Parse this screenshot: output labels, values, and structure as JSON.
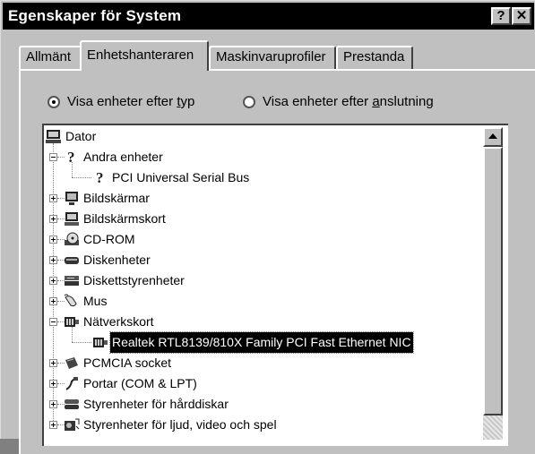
{
  "window": {
    "title": "Egenskaper för System"
  },
  "titlebar": {
    "help_label": "?",
    "close_label": "✕"
  },
  "tabs": [
    {
      "label": "Allmänt"
    },
    {
      "label": "Enhetshanteraren"
    },
    {
      "label": "Maskinvaruprofiler"
    },
    {
      "label": "Prestanda"
    }
  ],
  "view_options": {
    "by_type": {
      "pre": "Visa enheter efter ",
      "ul": "t",
      "post": "yp",
      "checked": true
    },
    "by_connection": {
      "pre": "Visa enheter efter ",
      "ul": "a",
      "post": "nslutning",
      "checked": false
    }
  },
  "tree": {
    "root": {
      "label": "Dator",
      "icon": "computer-icon"
    },
    "items": [
      {
        "label": "Andra enheter",
        "icon": "question-icon",
        "expanded": true
      },
      {
        "label": "PCI Universal Serial Bus",
        "icon": "question-icon",
        "child": true
      },
      {
        "label": "Bildskärmar",
        "icon": "monitor-icon"
      },
      {
        "label": "Bildskärmskort",
        "icon": "display-adapter-icon"
      },
      {
        "label": "CD-ROM",
        "icon": "cdrom-icon"
      },
      {
        "label": "Diskenheter",
        "icon": "disk-drive-icon"
      },
      {
        "label": "Diskettstyrenheter",
        "icon": "floppy-controller-icon"
      },
      {
        "label": "Mus",
        "icon": "mouse-icon"
      },
      {
        "label": "Nätverkskort",
        "icon": "network-card-icon",
        "expanded": true
      },
      {
        "label": "Realtek RTL8139/810X Family PCI Fast Ethernet NIC",
        "icon": "network-card-icon",
        "child": true,
        "selected": true
      },
      {
        "label": "PCMCIA socket",
        "icon": "pcmcia-icon"
      },
      {
        "label": "Portar (COM & LPT)",
        "icon": "port-icon"
      },
      {
        "label": "Styrenheter för hårddiskar",
        "icon": "hdd-controller-icon"
      },
      {
        "label": "Styrenheter för ljud, video och spel",
        "icon": "sound-icon"
      }
    ]
  }
}
